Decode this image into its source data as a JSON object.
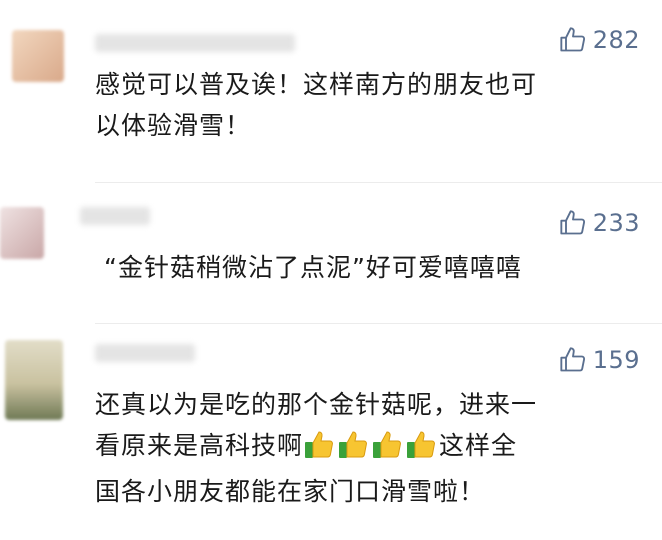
{
  "comments": [
    {
      "likes": "282",
      "text_lines": [
        "感觉可以普及诶！这样南方的朋友也可",
        "以体验滑雪！"
      ],
      "avatar_color": "#e8c7a8"
    },
    {
      "likes": "233",
      "text_lines": [
        "“金针菇稍微沾了点泥”好可爱嘻嘻嘻"
      ],
      "avatar_color": "#d9c2c2"
    },
    {
      "likes": "159",
      "text_lines": [
        "还真以为是吃的那个金针菇呢，进来一",
        "看原来是高科技啊",
        "这样全",
        "国各小朋友都能在家门口滑雪啦！"
      ],
      "avatar_color": "#c9c6a6"
    }
  ],
  "icons": {
    "like": "thumbs-up-outline-icon",
    "emoji": "thumbs-up-emoji-icon"
  },
  "colors": {
    "likes_text": "#5a6f8f",
    "body_text": "#1a1a1a"
  }
}
